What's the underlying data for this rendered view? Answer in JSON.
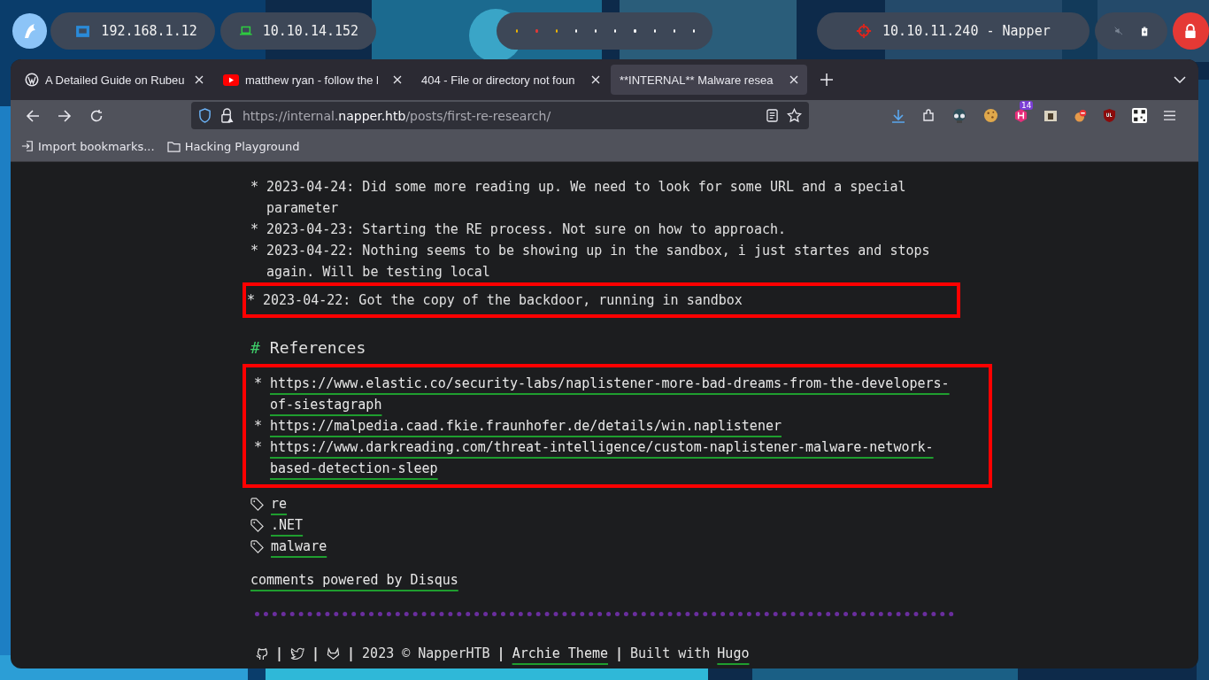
{
  "top_bar": {
    "addresses": [
      {
        "kind": "lan",
        "text": "192.168.1.12"
      },
      {
        "kind": "vpn",
        "text": "10.10.14.152"
      }
    ],
    "workspaces": [
      {
        "color": "#f2b600"
      },
      {
        "color": "#e53935"
      },
      {
        "color": "#f2b600"
      },
      {
        "color": "#ffffff"
      },
      {
        "color": "#ffffff"
      },
      {
        "color": "#ffffff"
      },
      {
        "color": "#ffffff"
      },
      {
        "color": "#ffffff"
      },
      {
        "color": "#ffffff"
      },
      {
        "color": "#ffffff"
      }
    ],
    "target": "10.10.11.240 - Napper"
  },
  "tabs": [
    {
      "kind": "wordpress",
      "title": "A Detailed Guide on Rubeu",
      "selected": false
    },
    {
      "kind": "youtube",
      "title": "matthew ryan - follow the l",
      "selected": false
    },
    {
      "kind": "none",
      "title": "404 - File or directory not foun",
      "selected": false
    },
    {
      "kind": "none",
      "title": "**INTERNAL** Malware resea",
      "selected": true
    }
  ],
  "url": {
    "prefix": "https://internal.",
    "domain": "napper.htb",
    "path": "/posts/first-re-research/"
  },
  "extension_badge": "14",
  "bookmarks": [
    {
      "kind": "import",
      "label": "Import bookmarks..."
    },
    {
      "kind": "folder",
      "label": "Hacking Playground"
    }
  ],
  "entries": [
    {
      "text": "2023-04-24: Did some more reading up. We need to look for some URL and a special parameter",
      "highlighted": false
    },
    {
      "text": "2023-04-23: Starting the RE process. Not sure on how to approach.",
      "highlighted": false
    },
    {
      "text": "2023-04-22: Nothing seems to be showing up in the sandbox, i just startes and stops again. Will be testing local",
      "highlighted": false
    },
    {
      "text": "2023-04-22: Got the copy of the backdoor, running in sandbox",
      "highlighted": true
    }
  ],
  "bullet": "*",
  "references": {
    "heading_mark": "#",
    "heading": "References",
    "highlighted": true,
    "links": [
      "https://www.elastic.co/security-labs/naplistener-more-bad-dreams-from-the-developers-of-siestagraph",
      "https://malpedia.caad.fkie.fraunhofer.de/details/win.naplistener",
      "https://www.darkreading.com/threat-intelligence/custom-naplistener-malware-network-based-detection-sleep"
    ]
  },
  "tags": [
    "re",
    ".NET",
    "malware"
  ],
  "comments_link": "comments powered by Disqus",
  "footer": [
    {
      "kind": "icon"
    },
    {
      "kind": "sep",
      "text": "|"
    },
    {
      "kind": "icon"
    },
    {
      "kind": "sep",
      "text": "|"
    },
    {
      "kind": "icon"
    },
    {
      "kind": "sep",
      "text": "|"
    },
    {
      "kind": "text",
      "text": "2023 © NapperHTB"
    },
    {
      "kind": "sep",
      "text": "|"
    },
    {
      "kind": "link",
      "text": "Archie Theme"
    },
    {
      "kind": "sep",
      "text": "|"
    },
    {
      "kind": "text",
      "text": "Built with"
    },
    {
      "kind": "link",
      "text": "Hugo"
    }
  ]
}
